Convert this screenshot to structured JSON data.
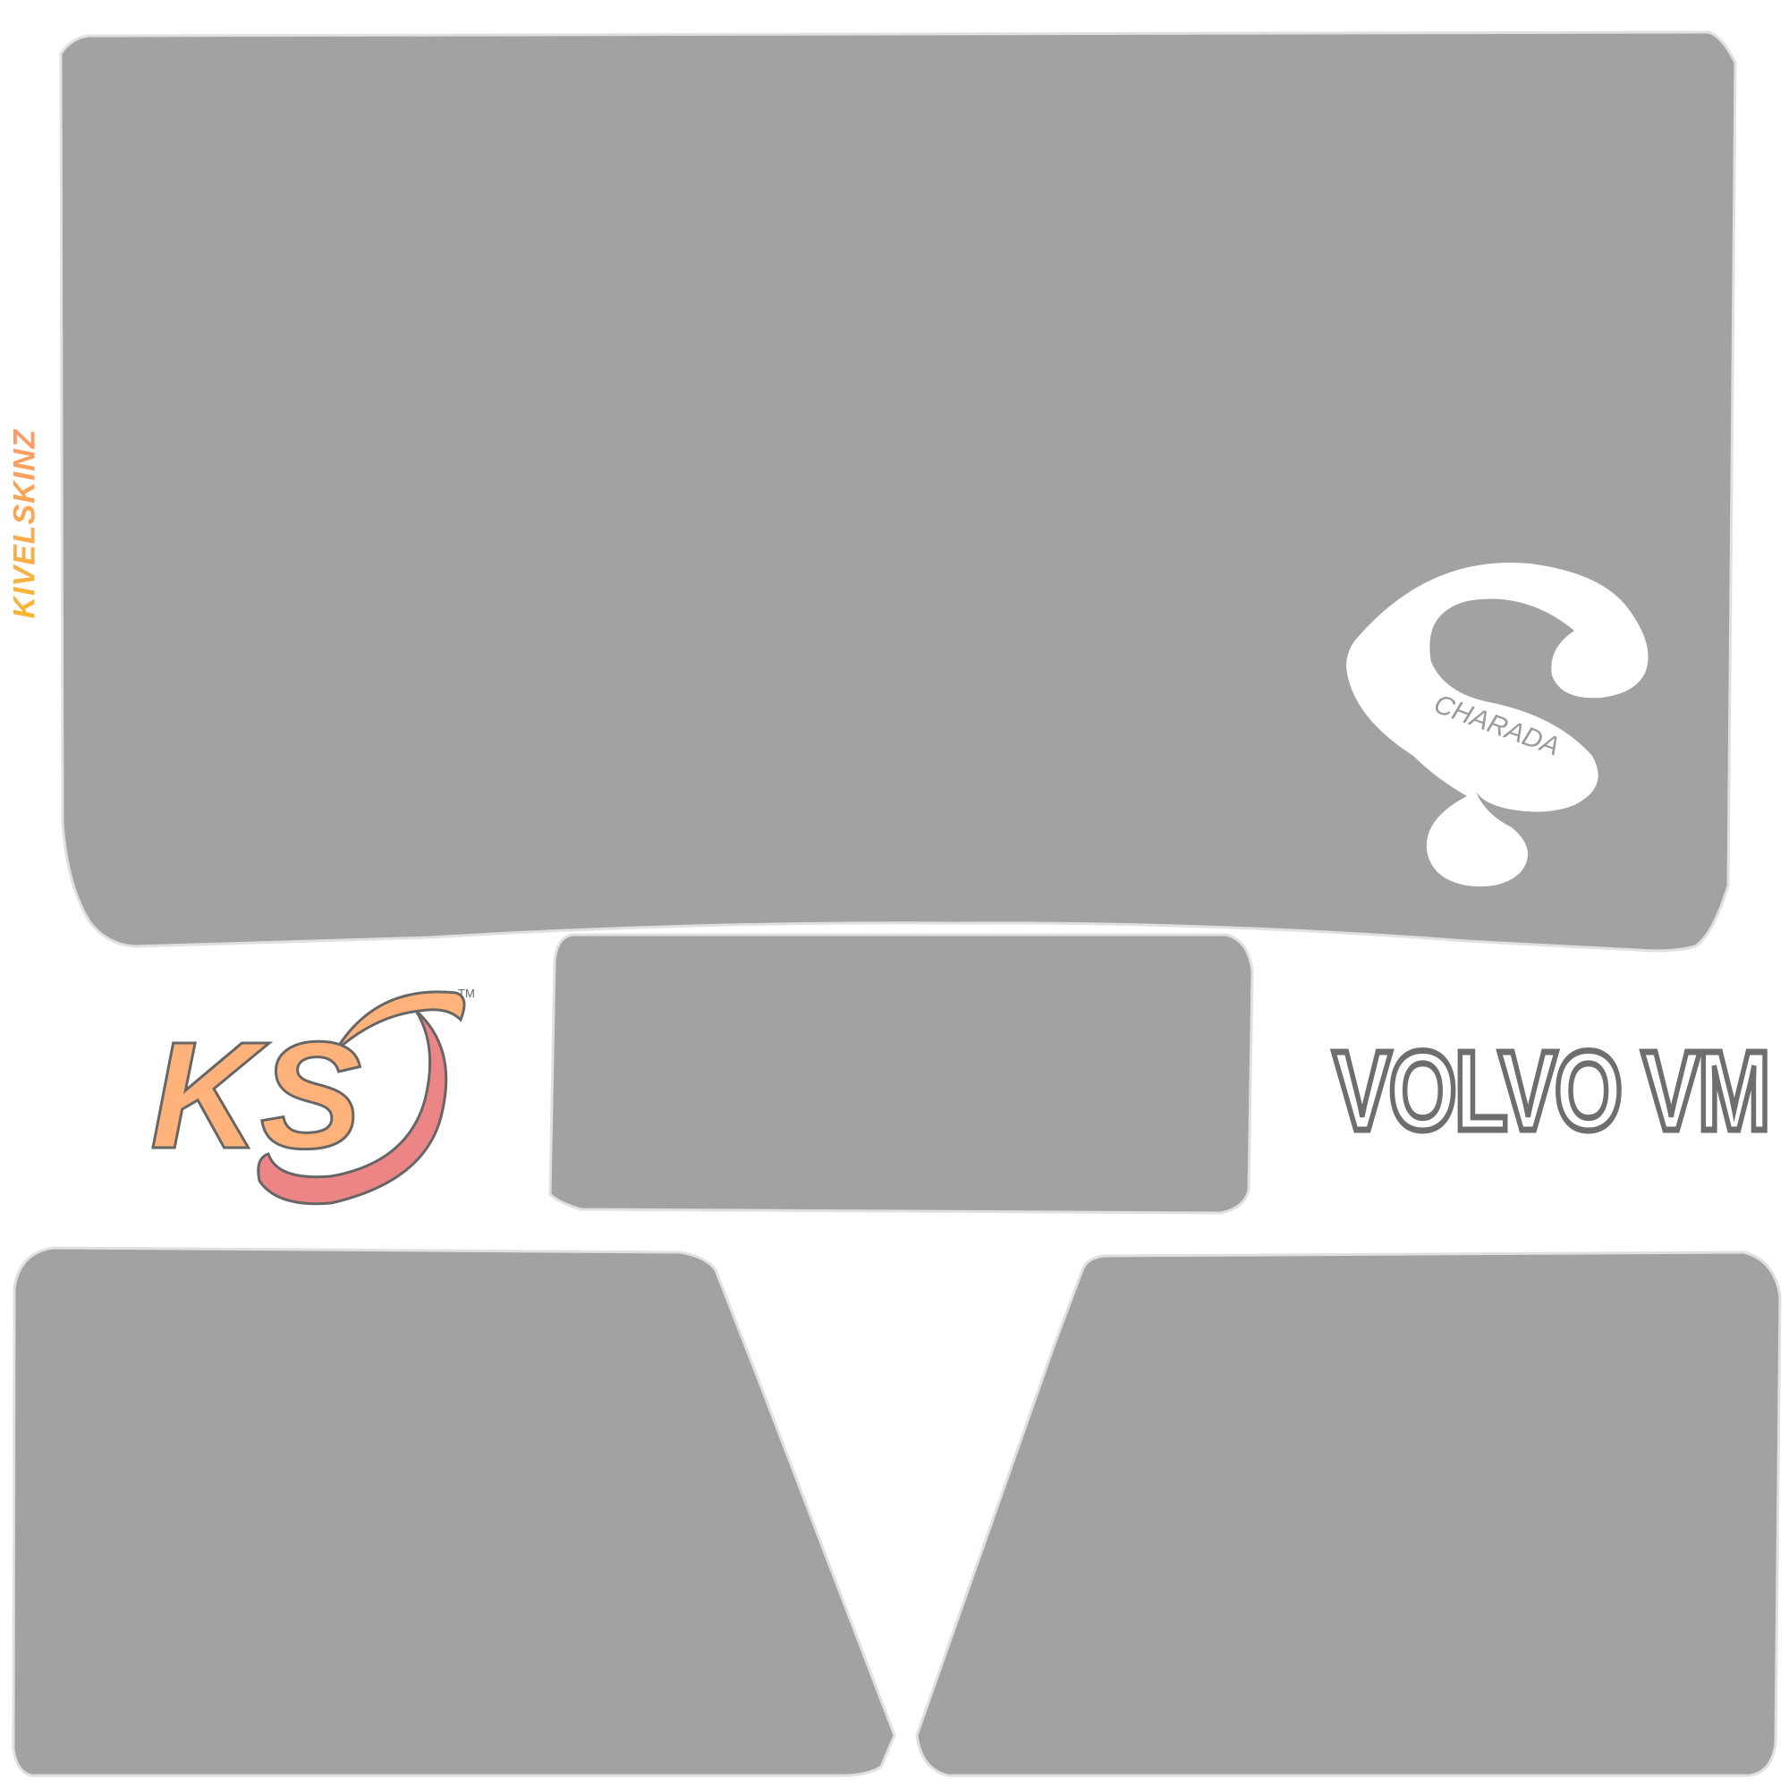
{
  "texts": {
    "side_brand": "KIVELSKINZ",
    "model": "VOLVO VM",
    "logo_letters": "KS",
    "trademark": "TM",
    "emblem_text": "CHARADA"
  },
  "colors": {
    "panel": "#a2a2a2",
    "panel_edge": "#e0e0e0",
    "background": "#ffffff",
    "logo_orange": "#ffb27a",
    "logo_pink": "#ec8585",
    "logo_outline": "#666666",
    "model_outline": "#6e6e6e",
    "emblem": "#ffffff"
  },
  "icons": {
    "brand_logo": "ks-swoosh-logo",
    "emblem": "charada-question-mark-emblem"
  }
}
